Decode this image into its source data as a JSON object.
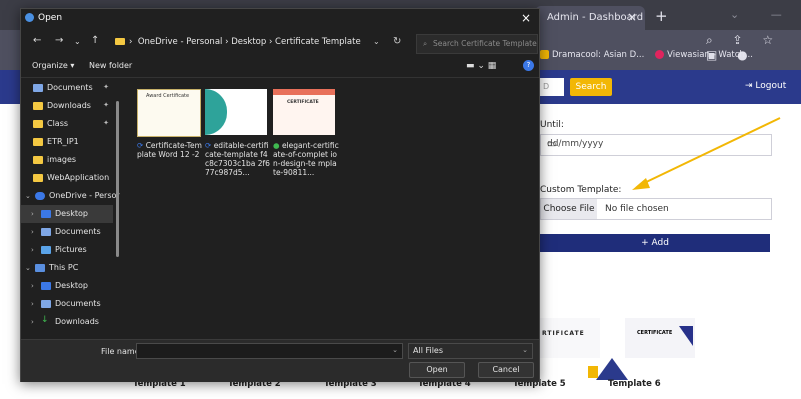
{
  "browser": {
    "tab_title": "Admin - Dashboard",
    "tab_close": "×",
    "new_tab": "+",
    "bookmarks": [
      "Dramacool: Asian D...",
      "Viewasian - Watch..."
    ],
    "logout": "Logout",
    "search_button": "Search",
    "input_stub": "D"
  },
  "form": {
    "until_label": "Until:",
    "date_placeholder": "dd/mm/yyyy",
    "custom_template_label": "Custom Template:",
    "choose_file": "Choose File",
    "no_file": "No file chosen",
    "add_button": "+ Add"
  },
  "templates": [
    "Template 1",
    "Template 2",
    "Template 3",
    "Template 4",
    "Template 5",
    "Template 6"
  ],
  "template_images": {
    "t5_text": "RTIFICATE",
    "t6_text": "CERTIFICATE"
  },
  "dialog": {
    "title": "Open",
    "close": "×",
    "breadcrumb": "OneDrive - Personal  ›  Desktop  ›  Certificate Template",
    "search_placeholder": "Search Certificate Template",
    "organize": "Organize ▾",
    "new_folder": "New folder",
    "nav_items": [
      {
        "label": "Documents",
        "pinned": true
      },
      {
        "label": "Downloads",
        "pinned": true
      },
      {
        "label": "Class",
        "pinned": true
      },
      {
        "label": "ETR_IP1",
        "pinned": false
      },
      {
        "label": "images",
        "pinned": false
      },
      {
        "label": "WebApplication",
        "pinned": false
      },
      {
        "label": "OneDrive - Persor",
        "pinned": false
      },
      {
        "label": "Desktop",
        "pinned": false
      },
      {
        "label": "Documents",
        "pinned": false
      },
      {
        "label": "Pictures",
        "pinned": false
      },
      {
        "label": "This PC",
        "pinned": false
      },
      {
        "label": "Desktop",
        "pinned": false
      },
      {
        "label": "Documents",
        "pinned": false
      },
      {
        "label": "Downloads",
        "pinned": false
      }
    ],
    "files": [
      {
        "name": "Certificate-Template-Word-12-2",
        "display": "Certificate-Tem plate Word 12 -2",
        "thumb_text": "Award Certificate"
      },
      {
        "name": "editable-certificate-template-f4c8c7303c1ba2f677c987d5",
        "display": "editable-certifi cate-template f4c8c7303c1ba 2f677c987d5...",
        "thumb_text": ""
      },
      {
        "name": "elegant-certificate-of-completion-design-template-90811",
        "display": "elegant-certific ate-of-complet ion-design-te mplate-90811...",
        "thumb_text": "CERTIFICATE"
      }
    ],
    "file_name_label": "File name:",
    "filter": "All Files",
    "open_button": "Open",
    "cancel_button": "Cancel"
  },
  "colors": {
    "header_blue": "#2b3a8c",
    "search_yellow": "#f2b705",
    "dialog_bg": "#202020",
    "arrow_yellow": "#f2b705"
  }
}
